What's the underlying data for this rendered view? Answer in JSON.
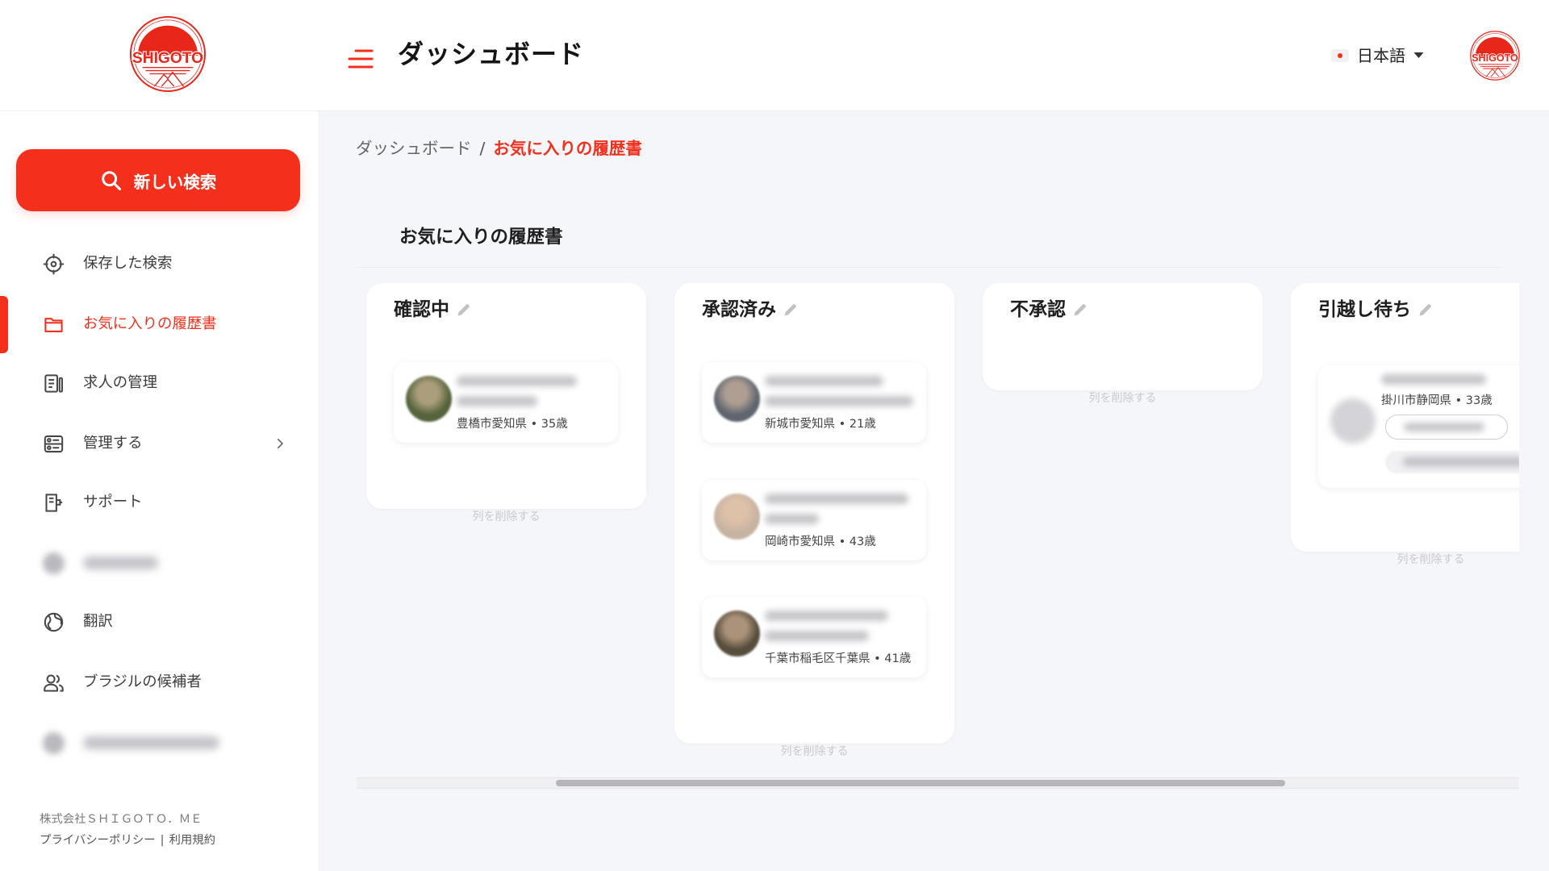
{
  "theme": {
    "accent": "#f4301c",
    "main_background": "#f5f6fa"
  },
  "brand": {
    "logo_text": "SHIGOTO"
  },
  "header": {
    "title": "ダッシュボード",
    "language": {
      "label": "日本語",
      "flag_icon": "japan-flag-icon"
    }
  },
  "sidebar": {
    "new_search": {
      "label": "新しい検索",
      "icon": "search-icon"
    },
    "items": [
      {
        "label": "保存した検索",
        "icon": "target-icon"
      },
      {
        "label": "お気に入りの履歴書",
        "icon": "folder-icon",
        "active": true
      },
      {
        "label": "求人の管理",
        "icon": "clipboard-icon"
      },
      {
        "label": "管理する",
        "icon": "settings-panel-icon",
        "has_submenu": true
      },
      {
        "label": "サポート",
        "icon": "support-icon"
      },
      {
        "label": "翻訳",
        "icon": "globe-icon"
      },
      {
        "label": "ブラジルの候補者",
        "icon": "people-icon"
      }
    ],
    "footer": {
      "company": "株式会社ＳＨＩＧＯＴＯ．ＭＥ",
      "privacy_link": "プライバシーポリシー",
      "separator": "|",
      "terms_link": "利用規約"
    }
  },
  "breadcrumb": {
    "parent": "ダッシュボード",
    "separator": "/",
    "current": "お気に入りの履歴書"
  },
  "page": {
    "section_title": "お気に入りの履歴書"
  },
  "board": {
    "delete_column_label": "列を削除する",
    "columns": [
      {
        "title": "確認中",
        "cards": [
          {
            "meta": "豊橋市愛知県 • 35歳",
            "avatar_color": "#55643d"
          }
        ]
      },
      {
        "title": "承認済み",
        "cards": [
          {
            "meta": "新城市愛知県 • 21歳",
            "avatar_color": "#5f6670"
          },
          {
            "meta": "岡崎市愛知県 • 43歳",
            "avatar_color": "#c7b3a2"
          },
          {
            "meta": "千葉市稲毛区千葉県 • 41歳",
            "avatar_color": "#574d3c"
          }
        ]
      },
      {
        "title": "不承認",
        "cards": []
      },
      {
        "title": "引越し待ち",
        "cards": [
          {
            "meta": "掛川市静岡県 • 33歳",
            "avatar_color": "#d4d4d8"
          }
        ]
      }
    ]
  }
}
